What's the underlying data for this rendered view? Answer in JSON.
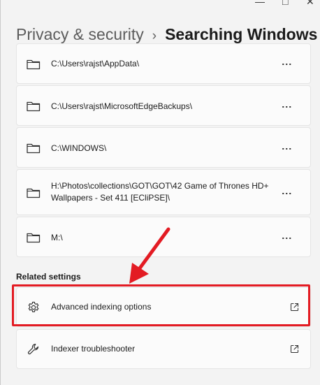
{
  "window": {
    "minimize_glyph": "—",
    "maximize_glyph": "□",
    "close_glyph": "✕"
  },
  "breadcrumb": {
    "parent": "Privacy & security",
    "separator": "›",
    "current": "Searching Windows"
  },
  "excluded_folders": [
    {
      "path": "C:\\Users\\rajst\\AppData\\",
      "icon": "folder-icon",
      "menu": "⋮"
    },
    {
      "path": "C:\\Users\\rajst\\MicrosoftEdgeBackups\\",
      "icon": "folder-icon",
      "menu": "⋮"
    },
    {
      "path": "C:\\WINDOWS\\",
      "icon": "folder-icon",
      "menu": "⋮"
    },
    {
      "path": "H:\\Photos\\collections\\GOT\\GOT\\42 Game of Thrones HD+ Wallpapers - Set 411 [ECliPSE]\\",
      "icon": "folder-icon",
      "menu": "⋮"
    },
    {
      "path": "M:\\",
      "icon": "folder-icon",
      "menu": "⋮"
    }
  ],
  "related_settings": {
    "title": "Related settings",
    "items": [
      {
        "label": "Advanced indexing options",
        "icon": "gear-icon",
        "trailing_icon": "external-link-icon"
      },
      {
        "label": "Indexer troubleshooter",
        "icon": "wrench-icon",
        "trailing_icon": "external-link-icon"
      }
    ]
  },
  "annotation": {
    "highlight_color": "#e31b23",
    "highlighted_item": "Advanced indexing options"
  }
}
